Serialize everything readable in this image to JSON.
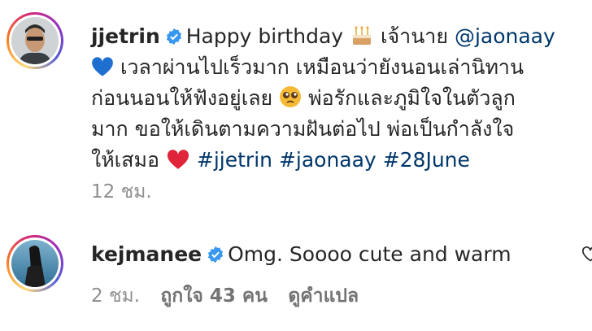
{
  "comments": [
    {
      "username": "jjetrin",
      "text_1": "Happy birthday",
      "text_2": "เจ้านาย",
      "mention": "@jaonaay",
      "line_2": "เวลาผ่านไปเร็วมาก เหมือนว่ายังนอนเล่านิทาน",
      "line_3a": "ก่อนนอนให้ฟังอยู่เลย",
      "line_3b": "พ่อรักและภูมิใจในตัวลูก",
      "line_4": "มาก ขอให้เดินตามความฝันต่อไป พ่อเป็นกำลังใจ",
      "line_5": "ให้เสมอ",
      "hashtags": [
        "#jjetrin",
        "#jaonaay",
        "#28June"
      ],
      "time": "12 ชม.",
      "icons": [
        "verified-badge-icon",
        "birthday-cake-emoji",
        "blue-heart-emoji",
        "pleading-face-emoji",
        "red-heart-emoji"
      ]
    },
    {
      "username": "kejmanee",
      "text": "Omg. Soooo cute and warm",
      "time": "2 ชม.",
      "likes": "ถูกใจ 43 คน",
      "translate": "ดูคำแปล",
      "icons": [
        "verified-badge-icon",
        "heart-outline-icon"
      ]
    }
  ],
  "colors": {
    "link": "#00376b",
    "meta": "#8e8e8e",
    "verified": "#3897f0",
    "text": "#262626"
  }
}
